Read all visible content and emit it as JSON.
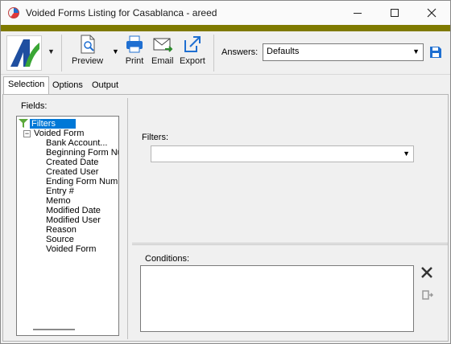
{
  "window": {
    "title": "Voided Forms Listing for Casablanca - areed"
  },
  "toolbar": {
    "preview_label": "Preview",
    "print_label": "Print",
    "email_label": "Email",
    "export_label": "Export",
    "answers_label": "Answers:",
    "answers_value": "Defaults"
  },
  "tabs": [
    {
      "label": "Selection",
      "active": true
    },
    {
      "label": "Options",
      "active": false
    },
    {
      "label": "Output",
      "active": false
    }
  ],
  "fields": {
    "legend": "Fields:",
    "filters_node": "Filters",
    "group_label": "Voided Form",
    "group_expander": "−",
    "items": [
      "Bank Account...",
      "Beginning Form Nu",
      "Created Date",
      "Created User",
      "Ending Form Numb",
      "Entry #",
      "Memo",
      "Modified Date",
      "Modified User",
      "Reason",
      "Source",
      "Voided Form"
    ]
  },
  "filters": {
    "label": "Filters:",
    "value": ""
  },
  "conditions": {
    "label": "Conditions:"
  },
  "colors": {
    "ribbon": "#7f7a00",
    "accent": "#0078d7",
    "logo_green": "#3aa635",
    "logo_blue": "#1f4fa0"
  },
  "icons": {
    "minimize": "minimize-icon",
    "maximize": "maximize-icon",
    "close": "close-icon",
    "save": "save-icon",
    "delete": "delete-icon",
    "add_condition": "add-condition-icon"
  }
}
